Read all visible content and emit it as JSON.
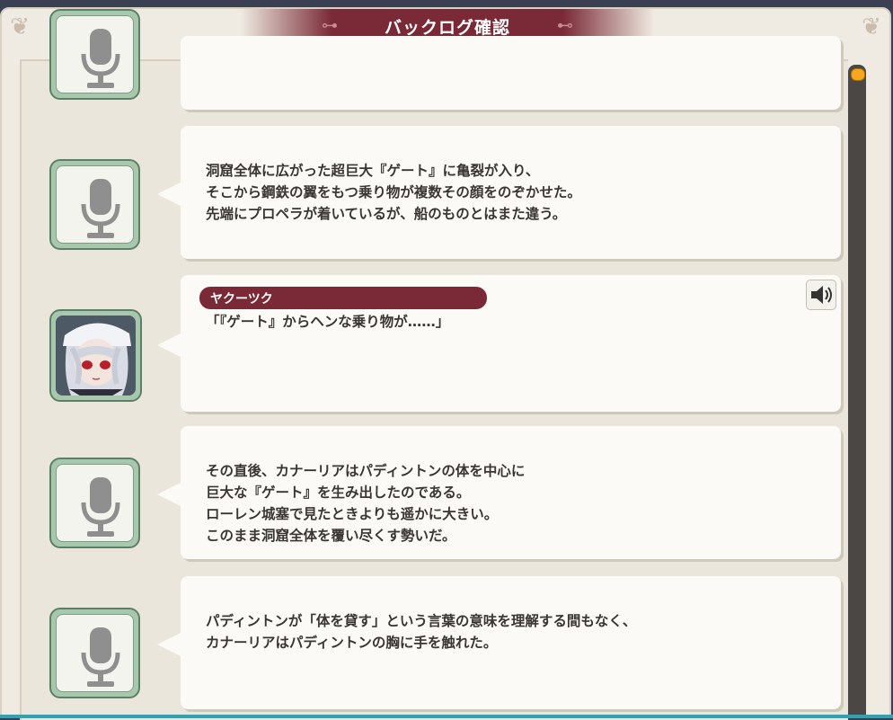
{
  "title": "バックログ確認",
  "log": [
    {
      "speaker": "",
      "text": "",
      "has_voice": false
    },
    {
      "speaker": "",
      "text": "洞窟全体に広がった超巨大『ゲート』に亀裂が入り、\nそこから鋼鉄の翼をもつ乗り物が複数その顔をのぞかせた。\n先端にプロペラが着いているが、船のものとはまた違う。",
      "has_voice": false
    },
    {
      "speaker": "ヤクーツク",
      "text": "「『ゲート』からヘンな乗り物が……」",
      "has_voice": true
    },
    {
      "speaker": "",
      "text": "その直後、カナーリアはパディントンの体を中心に\n巨大な『ゲート』を生み出したのである。\nローレン城塞で見たときよりも遥かに大きい。\nこのまま洞窟全体を覆い尽くす勢いだ。",
      "has_voice": false
    },
    {
      "speaker": "",
      "text": "パディントンが「体を貸す」という言葉の意味を理解する間もなく、\nカナーリアはパディントンの胸に手を触れた。",
      "has_voice": false
    }
  ],
  "icons": {
    "narration": "microphone-icon",
    "voice": "speaker-icon"
  },
  "colors": {
    "accent": "#7a2a36",
    "icon_frame": "#a7c8ad",
    "scroll_thumb": "#f5a81f"
  }
}
